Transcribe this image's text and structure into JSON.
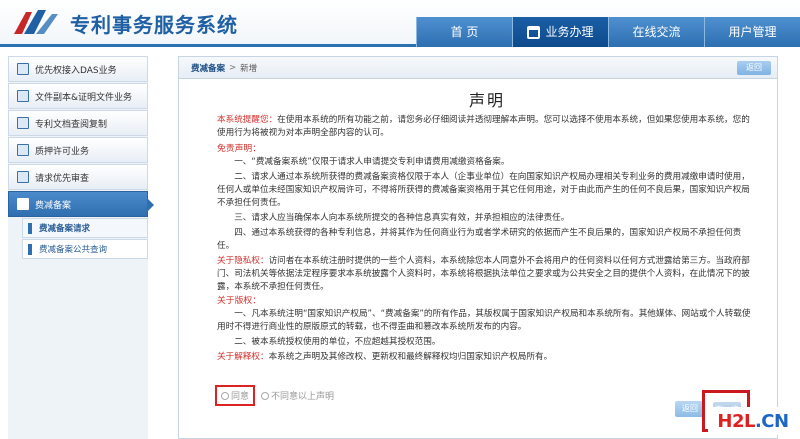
{
  "header": {
    "brand": "专利事务服务系统",
    "nav": [
      {
        "label": "首 页"
      },
      {
        "label": "业务办理"
      },
      {
        "label": "在线交流"
      },
      {
        "label": "用户管理"
      }
    ]
  },
  "sidebar": {
    "items": [
      {
        "label": "优先权接入DAS业务"
      },
      {
        "label": "文件副本&证明文件业务"
      },
      {
        "label": "专利文档查阅复制"
      },
      {
        "label": "质押许可业务"
      },
      {
        "label": "请求优先审查"
      },
      {
        "label": "费减备案"
      }
    ],
    "sub_items": [
      {
        "label": "费减备案请求"
      },
      {
        "label": "费减备案公共查询"
      }
    ]
  },
  "breadcrumb": {
    "section": "费减备案",
    "sep": ">",
    "current": "新增"
  },
  "buttons": {
    "back_top": "返回",
    "back_bottom": "返回",
    "next": "下一步"
  },
  "statement": {
    "title": "声明",
    "reminder_label": "本系统提醒您：",
    "reminder_text": "在使用本系统的所有功能之前，请您务必仔细阅读并透彻理解本声明。您可以选择不使用本系统，但如果您使用本系统，您的使用行为将被视为对本声明全部内容的认可。",
    "disclaimer_heading": "免责声明：",
    "disclaimer_1": "一、“费减备案系统”仅限于请求人申请提交专利申请费用减缴资格备案。",
    "disclaimer_2": "二、请求人通过本系统所获得的费减备案资格仅限于本人（企事业单位）在向国家知识产权局办理相关专利业务的费用减缴申请时使用，任何人或单位未经国家知识产权局许可，不得将所获得的费减备案资格用于其它任何用途，对于由此而产生的任何不良后果，国家知识产权局不承担任何责任。",
    "disclaimer_3": "三、请求人应当确保本人向本系统所提交的各种信息真实有效，并承担相应的法律责任。",
    "disclaimer_4": "四、通过本系统获得的各种专利信息，并将其作为任何商业行为或者学术研究的依据而产生不良后果的，国家知识产权局不承担任何责任。",
    "privacy_label": "关于隐私权：",
    "privacy_text": "访问者在本系统注册时提供的一些个人资料，本系统除您本人同意外不会将用户的任何资料以任何方式泄露给第三方。当政府部门、司法机关等依据法定程序要求本系统披露个人资料时，本系统将根据执法单位之要求或为公共安全之目的提供个人资料，在此情况下的披露，本系统不承担任何责任。",
    "copyright_heading": "关于版权：",
    "copyright_1": "一、凡本系统注明“国家知识产权局”、“费减备案”的所有作品，其版权属于国家知识产权局和本系统所有。其他媒体、网站或个人转载使用时不得进行商业性的原版原式的转载，也不得歪曲和篡改本系统所发布的内容。",
    "copyright_2": "二、被本系统授权使用的单位，不应超越其授权范围。",
    "interpret_label": "关于解释权：",
    "interpret_text": "本系统之声明及其修改权、更新权和最终解释权均归国家知识产权局所有。"
  },
  "options": {
    "agree": "同意",
    "disagree": "不同意以上声明"
  },
  "watermark": {
    "part1": "H2L",
    "part2": ".CN"
  }
}
